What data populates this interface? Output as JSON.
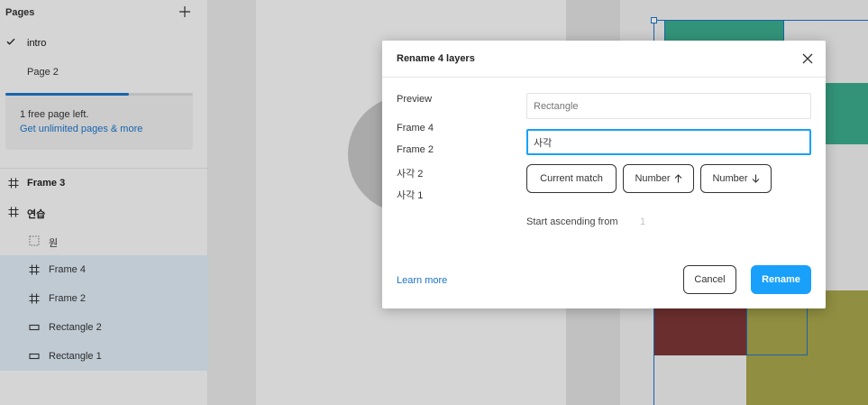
{
  "sidebar": {
    "pages_title": "Pages",
    "pages": [
      {
        "label": "intro",
        "active": true
      },
      {
        "label": "Page 2",
        "active": false
      }
    ],
    "plan": {
      "progress_fraction": 0.66,
      "message": "1 free page left.",
      "link": "Get unlimited pages & more"
    },
    "layers": [
      {
        "label": "Frame 3",
        "icon": "frame-icon"
      },
      {
        "label": "연습",
        "icon": "frame-icon"
      },
      {
        "label": "원",
        "icon": "ellipse-icon"
      },
      {
        "label": "Frame 4",
        "icon": "frame-icon"
      },
      {
        "label": "Frame 2",
        "icon": "frame-icon"
      },
      {
        "label": "Rectangle 2",
        "icon": "rectangle-icon"
      },
      {
        "label": "Rectangle 1",
        "icon": "rectangle-icon"
      }
    ]
  },
  "canvas": {
    "colors": {
      "teal": "#3aa98a",
      "red": "#7a3535",
      "yellow": "#a6a44a",
      "selection": "#1b73c7"
    }
  },
  "modal": {
    "title": "Rename 4 layers",
    "preview_label": "Preview",
    "preview_items": [
      "Frame 4",
      "Frame 2",
      "사각 2",
      "사각 1"
    ],
    "match_placeholder": "Rectangle",
    "rename_value": "사각",
    "buttons": {
      "current_match": "Current match",
      "number_asc": "Number",
      "number_desc": "Number",
      "cancel": "Cancel",
      "rename": "Rename"
    },
    "start_label": "Start ascending from",
    "start_value": "1",
    "learn_more": "Learn more",
    "accent": "#18a0fb"
  }
}
